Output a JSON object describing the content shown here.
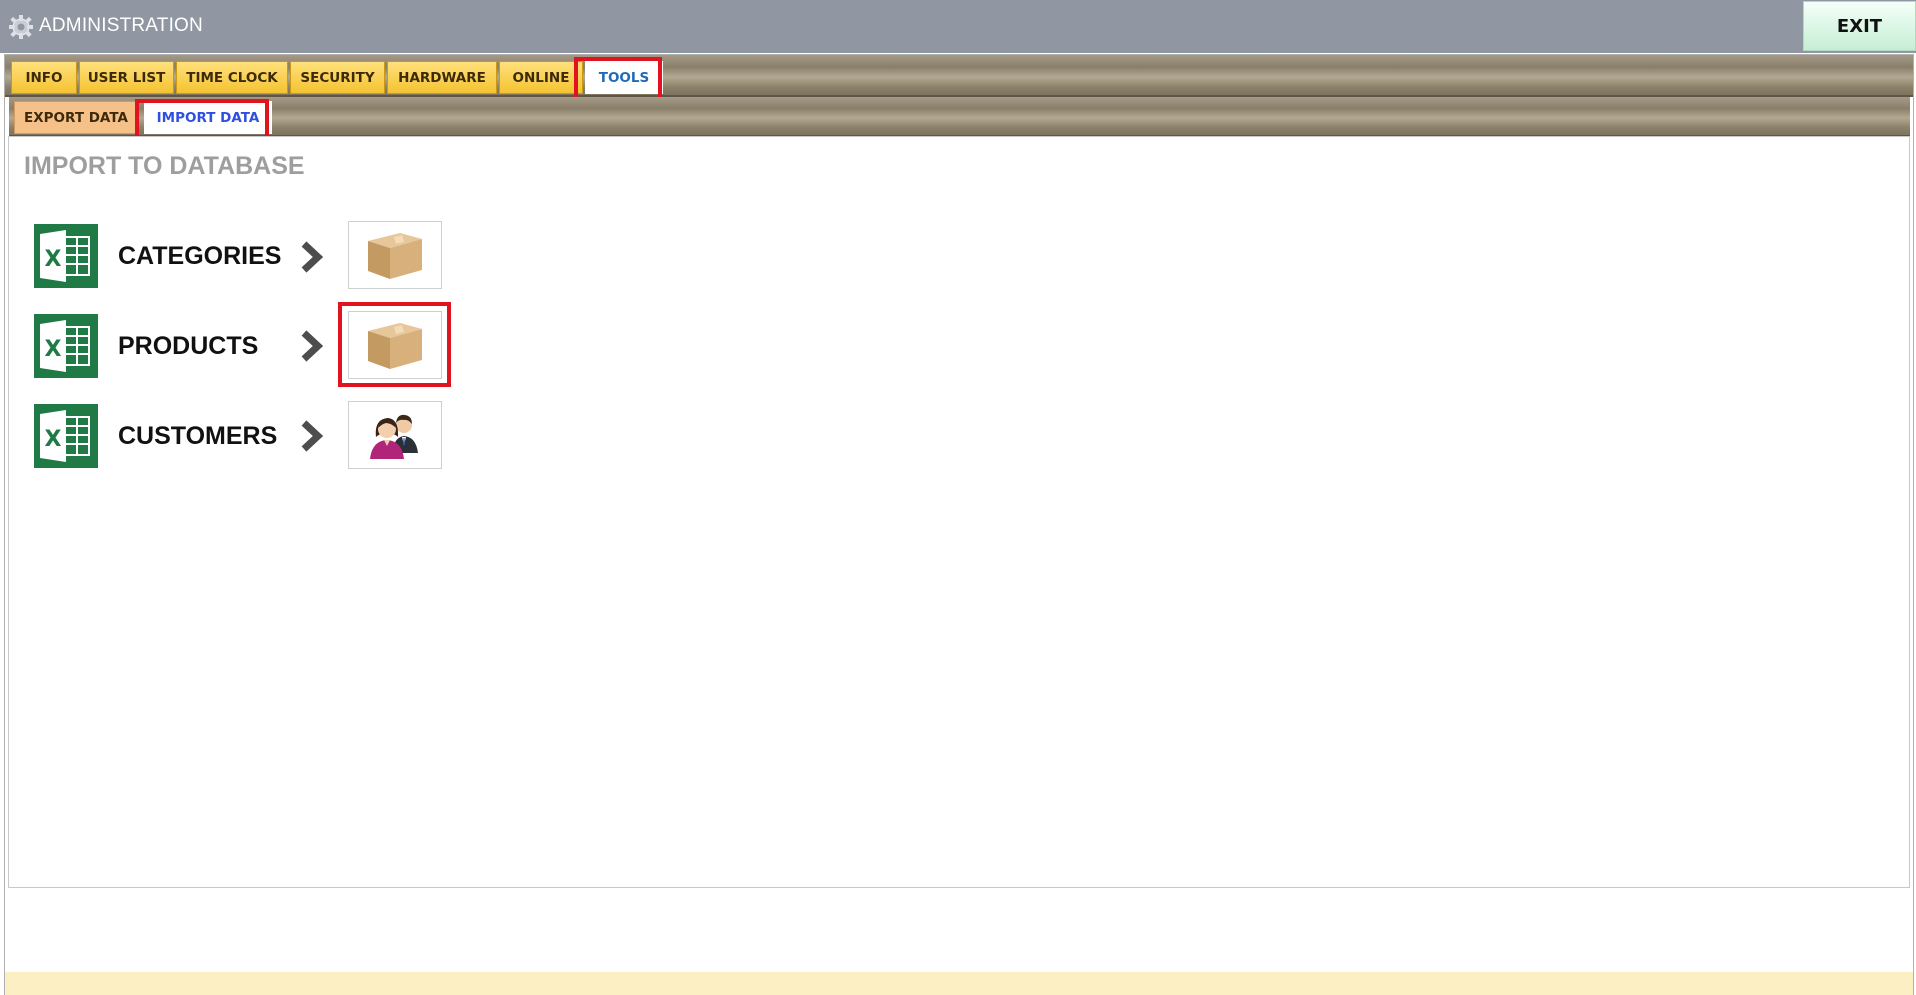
{
  "window": {
    "title": "ADMINISTRATION",
    "exit_label": "EXIT"
  },
  "main_tabs": [
    {
      "label": "INFO",
      "active": false
    },
    {
      "label": "USER LIST",
      "active": false
    },
    {
      "label": "TIME CLOCK",
      "active": false
    },
    {
      "label": "SECURITY",
      "active": false
    },
    {
      "label": "HARDWARE",
      "active": false
    },
    {
      "label": "ONLINE",
      "active": false
    },
    {
      "label": "TOOLS",
      "active": true
    }
  ],
  "sub_tabs": [
    {
      "label": "EXPORT DATA",
      "active": false
    },
    {
      "label": "IMPORT DATA",
      "active": true
    }
  ],
  "content": {
    "section_title": "IMPORT TO DATABASE",
    "rows": [
      {
        "label": "CATEGORIES",
        "icon": "box-icon"
      },
      {
        "label": "PRODUCTS",
        "icon": "box-icon"
      },
      {
        "label": "CUSTOMERS",
        "icon": "customers-icon"
      }
    ]
  },
  "colors": {
    "titlebar": "#9097a2",
    "tab_gold": "#f4c332",
    "highlight_red": "#e0141e",
    "excel_green": "#1f7a46",
    "footer": "#fdefc4"
  }
}
